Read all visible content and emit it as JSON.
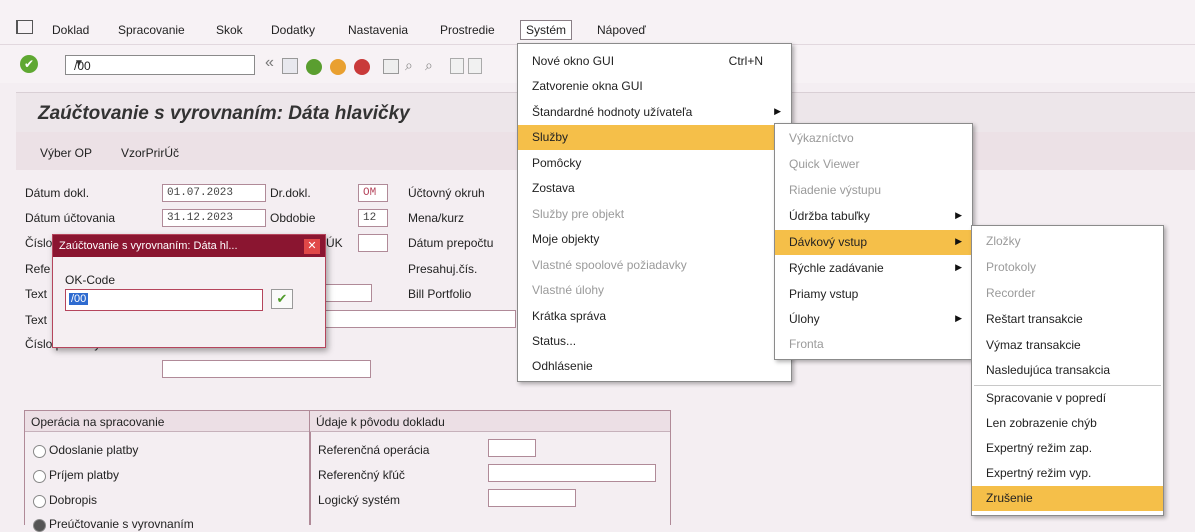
{
  "menubar": {
    "items": [
      "Doklad",
      "Spracovanie",
      "Skok",
      "Dodatky",
      "Nastavenia",
      "Prostredie",
      "Systém",
      "Nápoveď"
    ]
  },
  "toolbar": {
    "command_value": "/00"
  },
  "screen": {
    "title": "Zaúčtovanie s vyrovnaním: Dáta hlavičky",
    "app_buttons": [
      "Výber OP",
      "VzorPrirÚč"
    ]
  },
  "header_fields": {
    "doc_date_label": "Dátum dokl.",
    "doc_date": "01.07.2023",
    "posting_date_label": "Dátum účtovania",
    "posting_date": "31.12.2023",
    "number_label": "Číslo",
    "ref_label": "Refe",
    "text1_label": "Text",
    "text2_label": "Text",
    "branch_label": "Číslo pobočky",
    "doc_type_label": "Dr.dokl.",
    "doc_type": "OM",
    "period_label": "Obdobie",
    "period": "12",
    "uk_label": "ÚK",
    "company_label": "Účtovný okruh",
    "currency_label": "Mena/kurz",
    "recalc_label": "Dátum prepočtu",
    "cross_label": "Presahuj.čís.",
    "bill_label": "Bill Portfolio"
  },
  "popup": {
    "title": "Zaúčtovanie s vyrovnaním: Dáta hl...",
    "okcode_label": "OK-Code",
    "okcode_value": "/00"
  },
  "operations": {
    "title": "Operácia na spracovanie",
    "options": [
      "Odoslanie platby",
      "Príjem platby",
      "Dobropis",
      "Preúčtovanie s vyrovnaním"
    ]
  },
  "origin": {
    "title": "Údaje k pôvodu dokladu",
    "labels": [
      "Referenčná operácia",
      "Referenčný kľúč",
      "Logický systém"
    ]
  },
  "system_menu": {
    "items": [
      {
        "label": "Nové okno GUI",
        "shortcut": "Ctrl+N"
      },
      {
        "label": "Zatvorenie okna GUI"
      },
      {
        "label": "Štandardné hodnoty užívateľa"
      },
      {
        "label": "Služby"
      },
      {
        "label": "Pomôcky"
      },
      {
        "label": "Zostava"
      },
      {
        "label": "Služby pre objekt"
      },
      {
        "label": "Moje objekty"
      },
      {
        "label": "Vlastné spoolové požiadavky"
      },
      {
        "label": "Vlastné úlohy"
      },
      {
        "label": "Krátka správa"
      },
      {
        "label": "Status..."
      },
      {
        "label": "Odhlásenie"
      }
    ]
  },
  "services_menu": {
    "items": [
      "Výkazníctvo",
      "Quick Viewer",
      "Riadenie výstupu",
      "Údržba tabuľky",
      "Dávkový vstup",
      "Rýchle zadávanie",
      "Priamy vstup",
      "Úlohy",
      "Fronta"
    ]
  },
  "batch_menu": {
    "items": [
      "Zložky",
      "Protokoly",
      "Recorder",
      "Reštart transakcie",
      "Výmaz transakcie",
      "Nasledujúca transakcia",
      "Spracovanie v popredí",
      "Len zobrazenie chýb",
      "Expertný režim zap.",
      "Expertný režim vyp.",
      "Zrušenie"
    ]
  },
  "colors": {
    "highlight": "#f5bf49",
    "popup_header": "#8a1530"
  }
}
